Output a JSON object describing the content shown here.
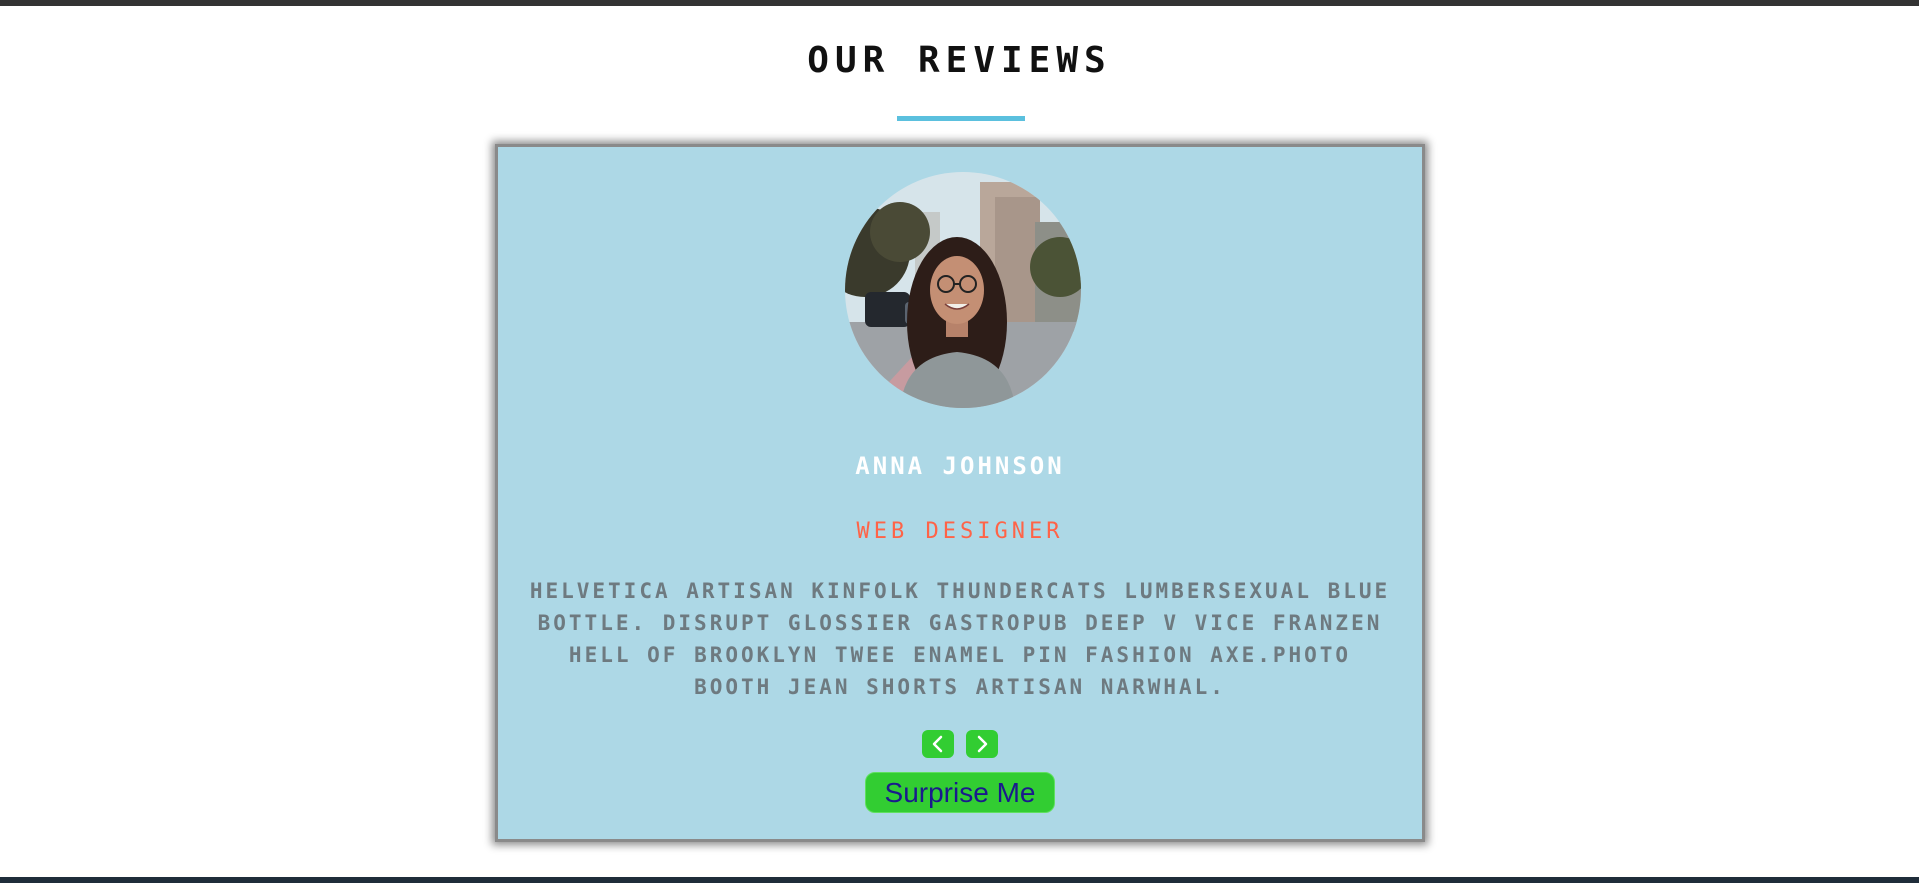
{
  "section": {
    "title": "OUR REVIEWS"
  },
  "review": {
    "name": "ANNA JOHNSON",
    "role": "WEB DESIGNER",
    "text": "HELVETICA ARTISAN KINFOLK THUNDERCATS LUMBERSEXUAL BLUE BOTTLE. DISRUPT GLOSSIER GASTROPUB DEEP V VICE FRANZEN HELL OF BROOKLYN TWEE ENAMEL PIN FASHION AXE.PHOTO BOOTH JEAN SHORTS ARTISAN NARWHAL."
  },
  "controls": {
    "prev_icon": "chevron-left-icon",
    "next_icon": "chevron-right-icon",
    "surprise_label": "Surprise Me"
  },
  "colors": {
    "accent": "#5bc0de",
    "card_background": "#add8e6",
    "button_green": "#32cd32",
    "role_color": "#ff6347"
  }
}
